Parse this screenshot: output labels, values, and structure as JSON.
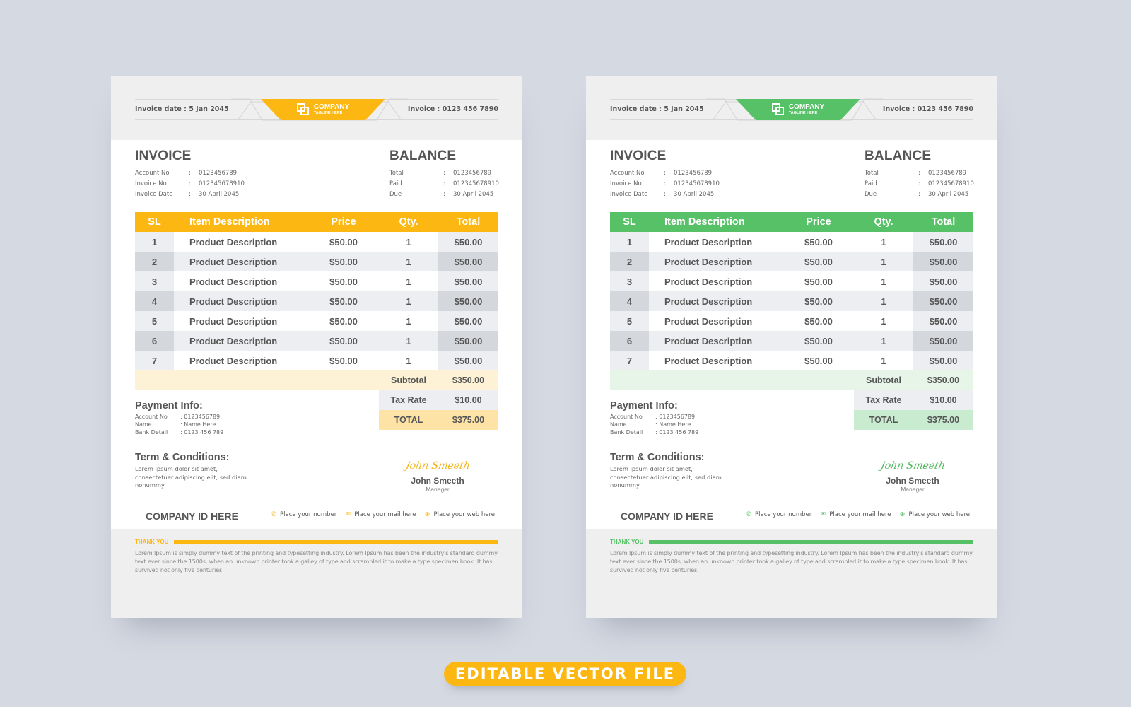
{
  "theme_colors": {
    "yellow": {
      "accent": "#fcb712",
      "summary_bg": "#fdf2d5",
      "total_bg": "#fde4a6",
      "signature": "#f0b416"
    },
    "green": {
      "accent": "#56c166",
      "summary_bg": "#e6f5e8",
      "total_bg": "#c9ebcf",
      "signature": "#4fb85e"
    },
    "banner": "#fcb712"
  },
  "invoices": [
    {
      "theme": "yellow",
      "header": {
        "invoice_date": "Invoice date :  5 Jan 2045",
        "invoice_number": "Invoice : 0123 456 7890",
        "logo_icon": "overlapping-squares-icon",
        "company": "COMPANY",
        "tagline": "TAGLINE HERE"
      },
      "invoice_block": {
        "title": "INVOICE",
        "rows": [
          {
            "label": "Account No",
            "value": "0123456789"
          },
          {
            "label": "Invoice No",
            "value": "012345678910"
          },
          {
            "label": "Invoice Date",
            "value": "30 April 2045"
          }
        ]
      },
      "balance_block": {
        "title": "BALANCE",
        "rows": [
          {
            "label": "Total",
            "value": "0123456789"
          },
          {
            "label": "Paid",
            "value": "012345678910"
          },
          {
            "label": "Due",
            "value": "30 April 2045"
          }
        ]
      },
      "table": {
        "headers": [
          "SL",
          "Item Description",
          "Price",
          "Qty.",
          "Total"
        ],
        "rows": [
          [
            "1",
            "Product Description",
            "$50.00",
            "1",
            "$50.00"
          ],
          [
            "2",
            "Product Description",
            "$50.00",
            "1",
            "$50.00"
          ],
          [
            "3",
            "Product Description",
            "$50.00",
            "1",
            "$50.00"
          ],
          [
            "4",
            "Product Description",
            "$50.00",
            "1",
            "$50.00"
          ],
          [
            "5",
            "Product Description",
            "$50.00",
            "1",
            "$50.00"
          ],
          [
            "6",
            "Product Description",
            "$50.00",
            "1",
            "$50.00"
          ],
          [
            "7",
            "Product Description",
            "$50.00",
            "1",
            "$50.00"
          ]
        ],
        "subtotal_label": "Subtotal",
        "subtotal": "$350.00",
        "tax_label": "Tax Rate",
        "tax": "$10.00",
        "total_label": "TOTAL",
        "total": "$375.00"
      },
      "payment": {
        "title": "Payment Info:",
        "rows": [
          {
            "label": "Account No",
            "value": ": 0123456789"
          },
          {
            "label": "Name",
            "value": ": Name Here"
          },
          {
            "label": "Bank Detail",
            "value": ": 0123 456 789"
          }
        ]
      },
      "terms": {
        "title": "Term & Conditions:",
        "text": "Lorem ipsum dolor sit amet, consectetuer adipiscing elit, sed diam nonummy"
      },
      "signature": {
        "script": "John Smeeth",
        "name": "John Smeeth",
        "role": "Manager"
      },
      "company_id": "COMPANY ID HERE",
      "contacts": [
        {
          "icon": "phone-icon",
          "glyph": "✆",
          "label": "Place your number"
        },
        {
          "icon": "mail-icon",
          "glyph": "✉",
          "label": "Place your mail here"
        },
        {
          "icon": "globe-icon",
          "glyph": "⊕",
          "label": "Place your web here"
        }
      ],
      "footer": {
        "thank_you": "THANK YOU",
        "text": "Lorem Ipsum is simply dummy text of the printing and typesetting industry. Lorem Ipsum has been the industry's standard dummy text ever since the 1500s, when an unknown printer took a galley of type and scrambled it to make a type specimen book. It has survived not only five centuries"
      }
    },
    {
      "theme": "green",
      "header": {
        "invoice_date": "Invoice date :  5 Jan 2045",
        "invoice_number": "Invoice : 0123 456 7890",
        "logo_icon": "overlapping-squares-icon",
        "company": "COMPANY",
        "tagline": "TAGLINE HERE"
      },
      "invoice_block": {
        "title": "INVOICE",
        "rows": [
          {
            "label": "Account No",
            "value": "0123456789"
          },
          {
            "label": "Invoice No",
            "value": "012345678910"
          },
          {
            "label": "Invoice Date",
            "value": "30 April 2045"
          }
        ]
      },
      "balance_block": {
        "title": "BALANCE",
        "rows": [
          {
            "label": "Total",
            "value": "0123456789"
          },
          {
            "label": "Paid",
            "value": "012345678910"
          },
          {
            "label": "Due",
            "value": "30 April 2045"
          }
        ]
      },
      "table": {
        "headers": [
          "SL",
          "Item Description",
          "Price",
          "Qty.",
          "Total"
        ],
        "rows": [
          [
            "1",
            "Product Description",
            "$50.00",
            "1",
            "$50.00"
          ],
          [
            "2",
            "Product Description",
            "$50.00",
            "1",
            "$50.00"
          ],
          [
            "3",
            "Product Description",
            "$50.00",
            "1",
            "$50.00"
          ],
          [
            "4",
            "Product Description",
            "$50.00",
            "1",
            "$50.00"
          ],
          [
            "5",
            "Product Description",
            "$50.00",
            "1",
            "$50.00"
          ],
          [
            "6",
            "Product Description",
            "$50.00",
            "1",
            "$50.00"
          ],
          [
            "7",
            "Product Description",
            "$50.00",
            "1",
            "$50.00"
          ]
        ],
        "subtotal_label": "Subtotal",
        "subtotal": "$350.00",
        "tax_label": "Tax Rate",
        "tax": "$10.00",
        "total_label": "TOTAL",
        "total": "$375.00"
      },
      "payment": {
        "title": "Payment Info:",
        "rows": [
          {
            "label": "Account No",
            "value": ": 0123456789"
          },
          {
            "label": "Name",
            "value": ": Name Here"
          },
          {
            "label": "Bank Detail",
            "value": ": 0123 456 789"
          }
        ]
      },
      "terms": {
        "title": "Term & Conditions:",
        "text": "Lorem ipsum dolor sit amet, consectetuer adipiscing elit, sed diam nonummy"
      },
      "signature": {
        "script": "John Smeeth",
        "name": "John Smeeth",
        "role": "Manager"
      },
      "company_id": "COMPANY ID HERE",
      "contacts": [
        {
          "icon": "phone-icon",
          "glyph": "✆",
          "label": "Place your number"
        },
        {
          "icon": "mail-icon",
          "glyph": "✉",
          "label": "Place your mail here"
        },
        {
          "icon": "globe-icon",
          "glyph": "⊕",
          "label": "Place your web here"
        }
      ],
      "footer": {
        "thank_you": "THANK YOU",
        "text": "Lorem Ipsum is simply dummy text of the printing and typesetting industry. Lorem Ipsum has been the industry's standard dummy text ever since the 1500s, when an unknown printer took a galley of type and scrambled it to make a type specimen book. It has survived not only five centuries"
      }
    }
  ],
  "banner": {
    "label": "EDITABLE VECTOR  FILE"
  }
}
